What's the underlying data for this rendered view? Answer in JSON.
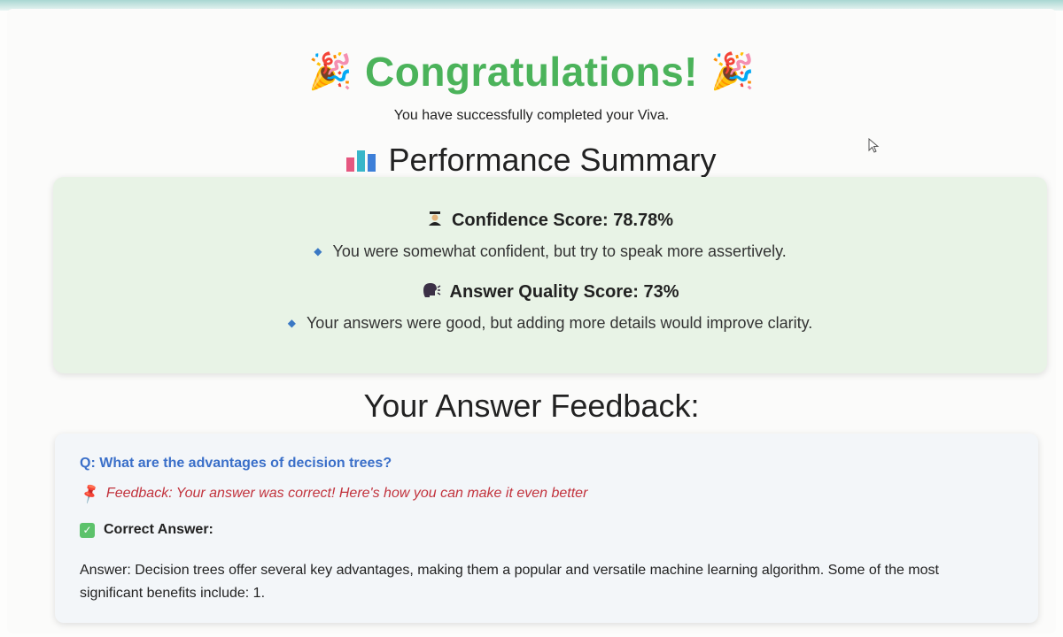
{
  "header": {
    "title": "Congratulations!",
    "title_emoji": "🎉",
    "subtitle": "You have successfully completed your Viva."
  },
  "summary": {
    "heading": "Performance Summary",
    "heading_icon": "bar-chart-icon",
    "confidence": {
      "icon": "graduate-icon",
      "label": "Confidence Score: 78.78%",
      "note": "You were somewhat confident, but try to speak more assertively."
    },
    "quality": {
      "icon": "speech-head-icon",
      "label": "Answer Quality Score: 73%",
      "note": "Your answers were good, but adding more details would improve clarity."
    }
  },
  "feedback": {
    "heading": "Your Answer Feedback:",
    "items": [
      {
        "question": "Q: What are the advantages of decision trees?",
        "feedback": "Feedback: Your answer was correct! Here's how you can make it even better",
        "correct_label": "Correct Answer:",
        "answer": "Answer: Decision trees offer several key advantages, making them a popular and versatile machine learning algorithm. Some of the most significant benefits include: 1."
      }
    ]
  },
  "colors": {
    "title_green": "#4bb35a",
    "summary_bg": "#e8f3e6",
    "question_blue": "#3a6fc9",
    "feedback_red": "#c2333d",
    "check_green": "#5cc26b"
  }
}
